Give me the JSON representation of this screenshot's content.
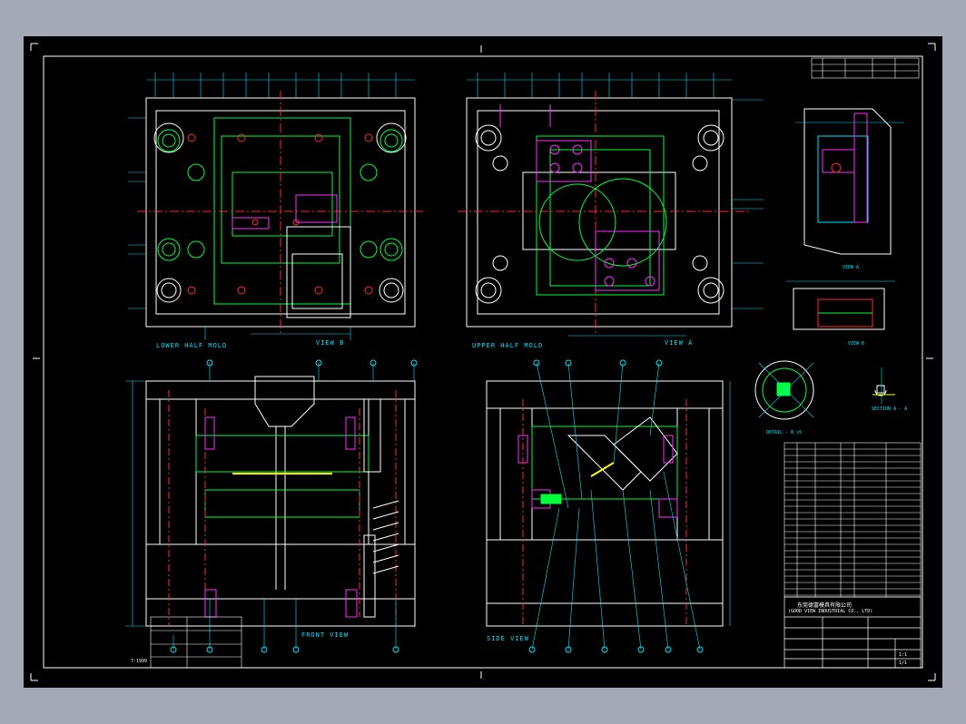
{
  "colors": {
    "background": "#000000",
    "border": "#ffffff",
    "dim": "#00e5ff",
    "part": "#00ff3a",
    "center": "#ff2a2a",
    "hidden": "#ff2bff",
    "yellow": "#ffff00",
    "frame": "#a3a9b6"
  },
  "views": {
    "lower_half": "LOWER HALF MOLD",
    "view_b": "VIEW B",
    "upper_half": "UPPER HALF MOLD",
    "view_a": "VIEW A",
    "front": "FRONT VIEW",
    "side": "SIDE VIEW",
    "view_a_small": "VIEW A",
    "view_b_small": "VIEW B",
    "detail": "DETAIL - B x5",
    "section": "SECTION A - A"
  },
  "title_block": {
    "company_cn": "东莞德富模具有限公司",
    "company_en": "(GOOD VIEW INDUSTRIAL CO., LTD)",
    "scale_label": "1:1",
    "sheet_label": "1/1"
  },
  "footer_note": "7-1999"
}
